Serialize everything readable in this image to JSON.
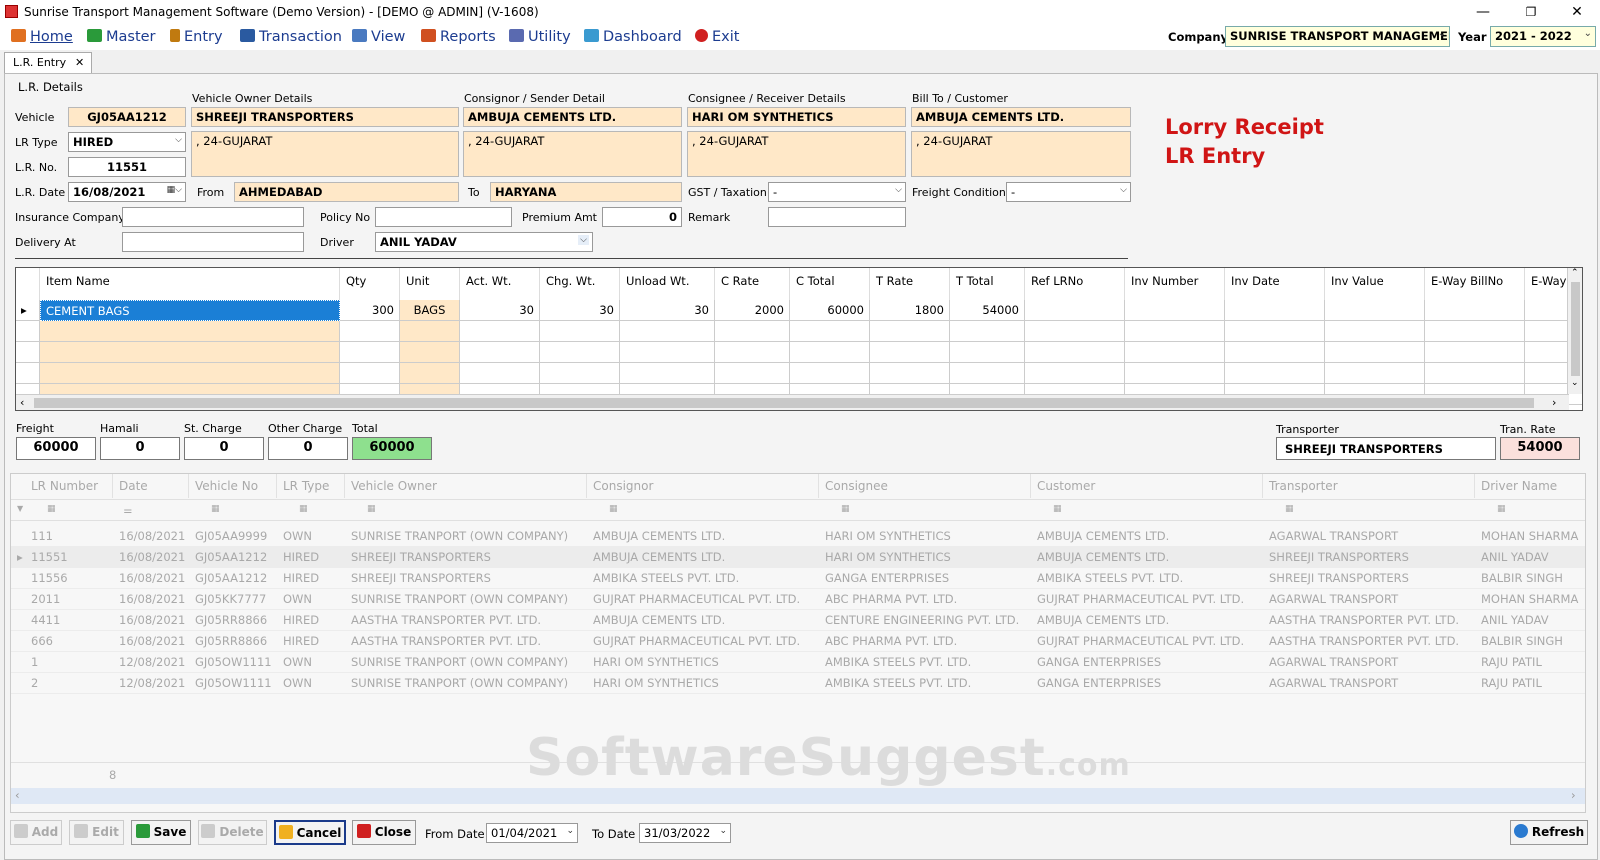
{
  "window": {
    "title": "Sunrise Transport Management Software (Demo Version) - [DEMO @ ADMIN] (V-1608)",
    "min_icon": "minimize-icon",
    "max_icon": "maximize-icon",
    "close_icon": "close-icon"
  },
  "menu": [
    {
      "label": "Home",
      "icon": "home-icon",
      "color": "#e07020"
    },
    {
      "label": "Master",
      "icon": "master-icon",
      "color": "#2a9a3a"
    },
    {
      "label": "Entry",
      "icon": "pencil-icon",
      "color": "#c07a10"
    },
    {
      "label": "Transaction",
      "icon": "transaction-icon",
      "color": "#2a5aa0"
    },
    {
      "label": "View",
      "icon": "view-icon",
      "color": "#4a7ac0"
    },
    {
      "label": "Reports",
      "icon": "chart-icon",
      "color": "#d05020"
    },
    {
      "label": "Utility",
      "icon": "utility-icon",
      "color": "#5a6ab0"
    },
    {
      "label": "Dashboard",
      "icon": "dashboard-icon",
      "color": "#3a9ad0"
    },
    {
      "label": "Exit",
      "icon": "exit-icon",
      "color": "#d02020"
    }
  ],
  "top": {
    "company_label": "Company",
    "company_value": "SUNRISE TRANSPORT MANAGEMENT",
    "year_label": "Year",
    "year_value": "2021 - 2022"
  },
  "tab": {
    "label": "L.R. Entry",
    "close": "✕"
  },
  "lr": {
    "group_title": "L.R. Details",
    "vehicle_label": "Vehicle",
    "vehicle": "GJ05AA1212",
    "lrtype_label": "LR Type",
    "lrtype": "HIRED",
    "lrno_label": "L.R. No.",
    "lrno": "11551",
    "lrdate_label": "L.R. Date",
    "lrdate": "16/08/2021",
    "owner_title": "Vehicle Owner Details",
    "owner_name": "SHREEJI TRANSPORTERS",
    "owner_addr": ", 24-GUJARAT",
    "consignor_title": "Consignor / Sender Detail",
    "consignor_name": "AMBUJA CEMENTS LTD.",
    "consignor_addr": ", 24-GUJARAT",
    "consignee_title": "Consignee / Receiver Details",
    "consignee_name": "HARI OM SYNTHETICS",
    "consignee_addr": ", 24-GUJARAT",
    "billto_title": "Bill To / Customer",
    "billto_name": "AMBUJA CEMENTS LTD.",
    "billto_addr": ", 24-GUJARAT",
    "from_label": "From",
    "from": "AHMEDABAD",
    "to_label": "To",
    "to": "HARYANA",
    "gst_label": "GST / Taxation",
    "gst": "-",
    "freightcond_label": "Freight Condition",
    "freightcond": "-",
    "insurance_label": "Insurance Company",
    "insurance": "",
    "policy_label": "Policy No",
    "policy": "",
    "premium_label": "Premium Amt",
    "premium": "0",
    "remark_label": "Remark",
    "remark": "",
    "delivery_label": "Delivery At",
    "delivery": "",
    "driver_label": "Driver",
    "driver": "ANIL YADAV",
    "heading1": "Lorry Receipt",
    "heading2": "LR Entry"
  },
  "items": {
    "headers": [
      "Item Name",
      "Qty",
      "Unit",
      "Act. Wt.",
      "Chg. Wt.",
      "Unload Wt.",
      "C Rate",
      "C Total",
      "T Rate",
      "T Total",
      "Ref LRNo",
      "Inv Number",
      "Inv Date",
      "Inv Value",
      "E-Way BillNo",
      "E-Way BillDat"
    ],
    "rows": [
      [
        "CEMENT BAGS",
        "300",
        "BAGS",
        "30",
        "30",
        "30",
        "2000",
        "60000",
        "1800",
        "54000",
        "",
        "",
        "",
        "",
        "",
        ""
      ]
    ]
  },
  "totals": {
    "freight_label": "Freight",
    "freight": "60000",
    "hamali_label": "Hamali",
    "hamali": "0",
    "stcharge_label": "St. Charge",
    "stcharge": "0",
    "other_label": "Other Charge",
    "other": "0",
    "total_label": "Total",
    "total": "60000",
    "transporter_label": "Transporter",
    "transporter": "SHREEJI TRANSPORTERS",
    "tranrate_label": "Tran. Rate",
    "tranrate": "54000"
  },
  "list": {
    "headers": [
      "LR Number",
      "Date",
      "Vehicle No",
      "LR Type",
      "Vehicle Owner",
      "Consignor",
      "Consignee",
      "Customer",
      "Transporter",
      "Driver Name"
    ],
    "rows": [
      [
        "111",
        "16/08/2021",
        "GJ05AA9999",
        "OWN",
        "SUNRISE TRANPORT (OWN COMPANY)",
        "AMBUJA CEMENTS LTD.",
        "HARI OM SYNTHETICS",
        "AMBUJA CEMENTS LTD.",
        "AGARWAL TRANSPORT",
        "MOHAN SHARMA"
      ],
      [
        "11551",
        "16/08/2021",
        "GJ05AA1212",
        "HIRED",
        "SHREEJI TRANSPORTERS",
        "AMBUJA CEMENTS LTD.",
        "HARI OM SYNTHETICS",
        "AMBUJA CEMENTS LTD.",
        "SHREEJI TRANSPORTERS",
        "ANIL YADAV"
      ],
      [
        "11556",
        "16/08/2021",
        "GJ05AA1212",
        "HIRED",
        "SHREEJI TRANSPORTERS",
        "AMBIKA STEELS PVT. LTD.",
        "GANGA ENTERPRISES",
        "AMBIKA STEELS PVT. LTD.",
        "SHREEJI TRANSPORTERS",
        "BALBIR SINGH"
      ],
      [
        "2011",
        "16/08/2021",
        "GJ05KK7777",
        "OWN",
        "SUNRISE TRANPORT (OWN COMPANY)",
        "GUJRAT PHARMACEUTICAL PVT. LTD.",
        "ABC PHARMA PVT. LTD.",
        "GUJRAT PHARMACEUTICAL PVT. LTD.",
        "AGARWAL TRANSPORT",
        "MOHAN SHARMA"
      ],
      [
        "4411",
        "16/08/2021",
        "GJ05RR8866",
        "HIRED",
        "AASTHA TRANSPORTER PVT. LTD.",
        "AMBUJA CEMENTS LTD.",
        "CENTURE ENGINEERING PVT. LTD.",
        "AMBUJA CEMENTS LTD.",
        "AASTHA TRANSPORTER PVT. LTD.",
        "ANIL YADAV"
      ],
      [
        "666",
        "16/08/2021",
        "GJ05RR8866",
        "HIRED",
        "AASTHA TRANSPORTER PVT. LTD.",
        "GUJRAT PHARMACEUTICAL PVT. LTD.",
        "ABC PHARMA PVT. LTD.",
        "GUJRAT PHARMACEUTICAL PVT. LTD.",
        "AASTHA TRANSPORTER PVT. LTD.",
        "BALBIR SINGH"
      ],
      [
        "1",
        "12/08/2021",
        "GJ05OW1111",
        "OWN",
        "SUNRISE TRANPORT (OWN COMPANY)",
        "HARI OM SYNTHETICS",
        "AMBIKA STEELS PVT. LTD.",
        "GANGA ENTERPRISES",
        "AGARWAL TRANSPORT",
        "RAJU PATIL"
      ],
      [
        "2",
        "12/08/2021",
        "GJ05OW1111",
        "OWN",
        "SUNRISE TRANPORT (OWN COMPANY)",
        "HARI OM SYNTHETICS",
        "AMBIKA STEELS PVT. LTD.",
        "GANGA ENTERPRISES",
        "AGARWAL TRANSPORT",
        "RAJU PATIL"
      ]
    ],
    "count": "8",
    "filter_eq": "="
  },
  "watermark": {
    "main": "SoftwareSuggest",
    "suffix": ".com"
  },
  "bottom": {
    "add": "Add",
    "edit": "Edit",
    "save": "Save",
    "delete": "Delete",
    "cancel": "Cancel",
    "close": "Close",
    "fromdate_label": "From Date",
    "fromdate": "01/04/2021",
    "todate_label": "To Date",
    "todate": "31/03/2022",
    "refresh": "Refresh"
  }
}
